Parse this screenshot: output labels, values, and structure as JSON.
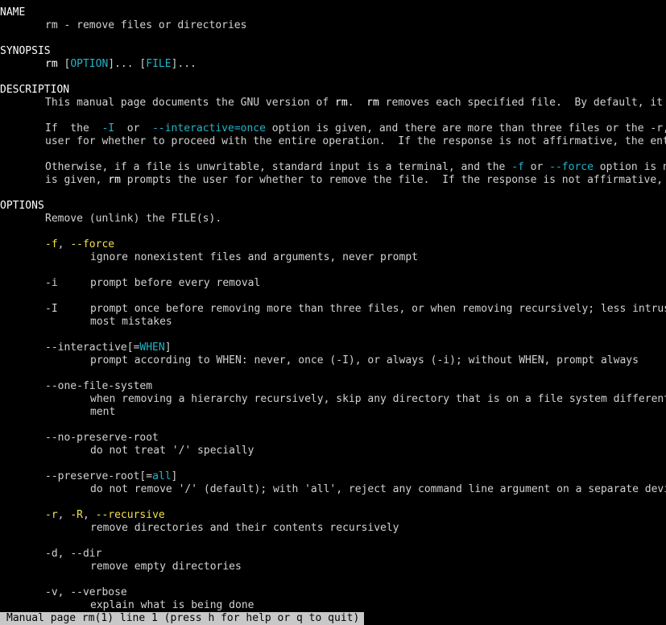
{
  "colors": {
    "background": "#000000",
    "text": "#d2d2d2",
    "bold": "#ffffff",
    "cyan_underline": "#22b4c8",
    "yellow_option": "#f0e04a",
    "status_bar_bg": "#c8c8c8",
    "status_bar_fg": "#000000"
  },
  "name": {
    "heading": "NAME",
    "text": "rm - remove files or directories"
  },
  "synopsis": {
    "heading": "SYNOPSIS",
    "cmd": "rm",
    "open1": " [",
    "option": "OPTION",
    "close1": "]... [",
    "file": "FILE",
    "close2": "]..."
  },
  "description": {
    "heading": "DESCRIPTION",
    "p1": {
      "a": "This manual page documents the GNU version of ",
      "rm1": "rm",
      "b": ".  ",
      "rm2": "rm",
      "c": " removes each specified file.  By default, it does not remove directories."
    },
    "p2": {
      "a": "If  the  ",
      "opt1": "-I",
      "b": "  or  ",
      "opt2": "--interactive=once",
      "c": " option is given, and there are more than three files or the -r, -R, or --recursive are given, then",
      "line2": "user for whether to proceed with the entire operation.  If the response is not affirmative, the entire command is aborted."
    },
    "p3": {
      "a": "Otherwise, if a file is unwritable, standard input is a terminal, and the ",
      "opt1": "-f",
      "b": " or ",
      "opt2": "--force",
      "c": " option is not given, or the -i or --interactive=always option",
      "d": "is given, ",
      "rm": "rm",
      "e": " prompts the user for whether to remove the file.  If the response is not affirmative, the file is skipped."
    }
  },
  "options": {
    "heading": "OPTIONS",
    "intro": "Remove (unlink) the FILE(s).",
    "force": {
      "opt1": "-f",
      "sep": ", ",
      "opt2": "--force",
      "desc": "ignore nonexistent files and arguments, never prompt"
    },
    "i": {
      "opt": "-i",
      "desc": "prompt before every removal"
    },
    "I": {
      "opt": "-I",
      "desc": "prompt once before removing more than three files, or when removing recursively; less intrusive than -i, while still giving protection against",
      "desc2": "most mistakes"
    },
    "interactive": {
      "opt": "--interactive",
      "open": "[=",
      "arg": "WHEN",
      "close": "]",
      "desc": "prompt according to WHEN: never, once (-I), or always (-i); without WHEN, prompt always"
    },
    "one_file_system": {
      "opt": "--one-file-system",
      "desc": "when removing a hierarchy recursively, skip any directory that is on a file system different from that of the corresponding command line argu-",
      "desc2": "ment"
    },
    "no_preserve_root": {
      "opt": "--no-preserve-root",
      "desc": "do not treat '/' specially"
    },
    "preserve_root": {
      "opt": "--preserve-root",
      "open": "[=",
      "arg": "all",
      "close": "]",
      "desc": "do not remove '/' (default); with 'all', reject any command line argument on a separate device from its parent"
    },
    "recursive": {
      "opt1": "-r",
      "sep1": ", ",
      "opt2": "-R",
      "sep2": ", ",
      "opt3": "--recursive",
      "desc": "remove directories and their contents recursively"
    },
    "dir": {
      "opt1": "-d",
      "sep": ", ",
      "opt2": "--dir",
      "desc": "remove empty directories"
    },
    "verbose": {
      "opt1": "-v",
      "sep": ", ",
      "opt2": "--verbose",
      "desc": "explain what is being done"
    }
  },
  "status_bar": {
    "text": "Manual page rm(1) line 1 (press h for help or q to quit)"
  }
}
